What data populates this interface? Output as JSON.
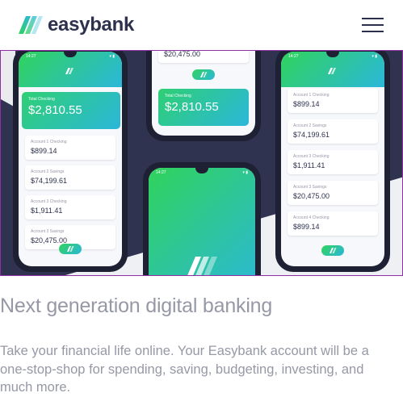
{
  "header": {
    "logo_text": "easybank",
    "menu_icon": "hamburger-icon"
  },
  "hero": {
    "phones": [
      {
        "status_time": "14:27",
        "balance_label": "Total Checking",
        "balance_value": "$2,810.55",
        "accounts": [
          {
            "label": "Account 1 Checking",
            "value": "$899.14"
          },
          {
            "label": "Account 2 Savings",
            "value": "$74,199.61"
          },
          {
            "label": "Account 3 Checking",
            "value": "$1,911.41"
          },
          {
            "label": "Account 3 Savings",
            "value": "$20,475.00"
          }
        ]
      },
      {
        "top_value": "$20,475.00",
        "balance_label": "Total Checking",
        "balance_value": "$2,810.55"
      },
      {
        "status_time": "14:27",
        "accounts": [
          {
            "label": "Account 1 Checking",
            "value": "$899.14"
          },
          {
            "label": "Account 2 Savings",
            "value": "$74,199.61"
          },
          {
            "label": "Account 3 Checking",
            "value": "$1,911.41"
          },
          {
            "label": "Account 3 Savings",
            "value": "$20,475.00"
          },
          {
            "label": "Account 4 Checking",
            "value": "$899.14"
          }
        ]
      },
      {
        "status_time": "14:27"
      }
    ]
  },
  "content": {
    "headline": "Next generation digital banking",
    "description": "Take your financial life online. Your Easybank account will be a one-stop-shop for spending, saving, budgeting, investing, and much more."
  },
  "colors": {
    "dark_blue": "#2d314d",
    "grayish_blue": "#9698a6",
    "lime_green": "#31d35c",
    "bright_cyan": "#2bb7da"
  }
}
